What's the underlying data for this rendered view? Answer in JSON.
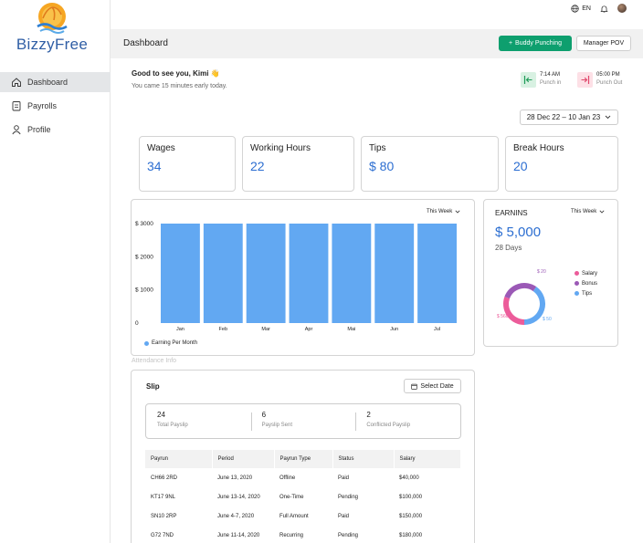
{
  "app": {
    "brand": "BizzyFree"
  },
  "sidebar": {
    "items": [
      {
        "label": "Dashboard",
        "icon": "home-icon",
        "active": true
      },
      {
        "label": "Payrolls",
        "icon": "clipboard-icon",
        "active": false
      },
      {
        "label": "Profile",
        "icon": "user-icon",
        "active": false
      }
    ]
  },
  "topbar": {
    "language": "EN"
  },
  "header": {
    "title": "Dashboard",
    "buddy_button": "Buddy Punching",
    "manager_button": "Manager POV"
  },
  "greeting": {
    "title": "Good to see you, Kimi 👋",
    "subtitle": "You came 15 minutes early today."
  },
  "punch_in": {
    "time": "7:14 AM",
    "label": "Punch in"
  },
  "punch_out": {
    "time": "05:00 PM",
    "label": "Punch Out"
  },
  "date_range": "28 Dec 22 – 10 Jan 23",
  "stats": [
    {
      "label": "Wages",
      "value": "34"
    },
    {
      "label": "Working Hours",
      "value": "22"
    },
    {
      "label": "Tips",
      "value": "$ 80"
    },
    {
      "label": "Break Hours",
      "value": "20"
    }
  ],
  "chart_data": {
    "type": "bar",
    "categories": [
      "Jan",
      "Feb",
      "Mar",
      "Apr",
      "Mai",
      "Jun",
      "Jul"
    ],
    "series": [
      {
        "name": "Earning Per Month",
        "values": [
          3000,
          3000,
          3000,
          3000,
          3000,
          3000,
          3000
        ]
      }
    ],
    "y_ticks": [
      "$ 3000",
      "$ 2000",
      "$ 1000",
      "0"
    ],
    "ylim": [
      0,
      3000
    ],
    "period_select": "This Week",
    "bar_color": "#62a8f2",
    "legend_placement": "bottom-left"
  },
  "earnings": {
    "title": "EARNINS",
    "period_select": "This Week",
    "amount": "$ 5,000",
    "days": "28 Days",
    "donut": [
      {
        "name": "Salary",
        "value": "$ 560",
        "color": "#ec5c9a"
      },
      {
        "name": "Bonus",
        "value": "$ 20",
        "color": "#9b59b6"
      },
      {
        "name": "Tips",
        "value": "$ 50",
        "color": "#62a8f2"
      }
    ]
  },
  "attendance_label": "Attendance Info",
  "slip": {
    "title": "Slip",
    "select_date": "Select Date",
    "summary": [
      {
        "value": "24",
        "label": "Total Payslip"
      },
      {
        "value": "6",
        "label": "Payslip Sent"
      },
      {
        "value": "2",
        "label": "Conflicted Payslip"
      }
    ],
    "columns": [
      "Payrun",
      "Period",
      "Payrun Type",
      "Status",
      "Salary"
    ],
    "rows": [
      [
        "CH66 2RD",
        "June 13, 2020",
        "Offline",
        "Paid",
        "$40,000"
      ],
      [
        "KT17 9NL",
        "June 13-14, 2020",
        "One-Time",
        "Pending",
        "$100,000"
      ],
      [
        "SN10 2RP",
        "June 4-7, 2020",
        "Full Amount",
        "Paid",
        "$150,000"
      ],
      [
        "G72 7ND",
        "June 11-14, 2020",
        "Recurring",
        "Pending",
        "$180,000"
      ]
    ]
  }
}
